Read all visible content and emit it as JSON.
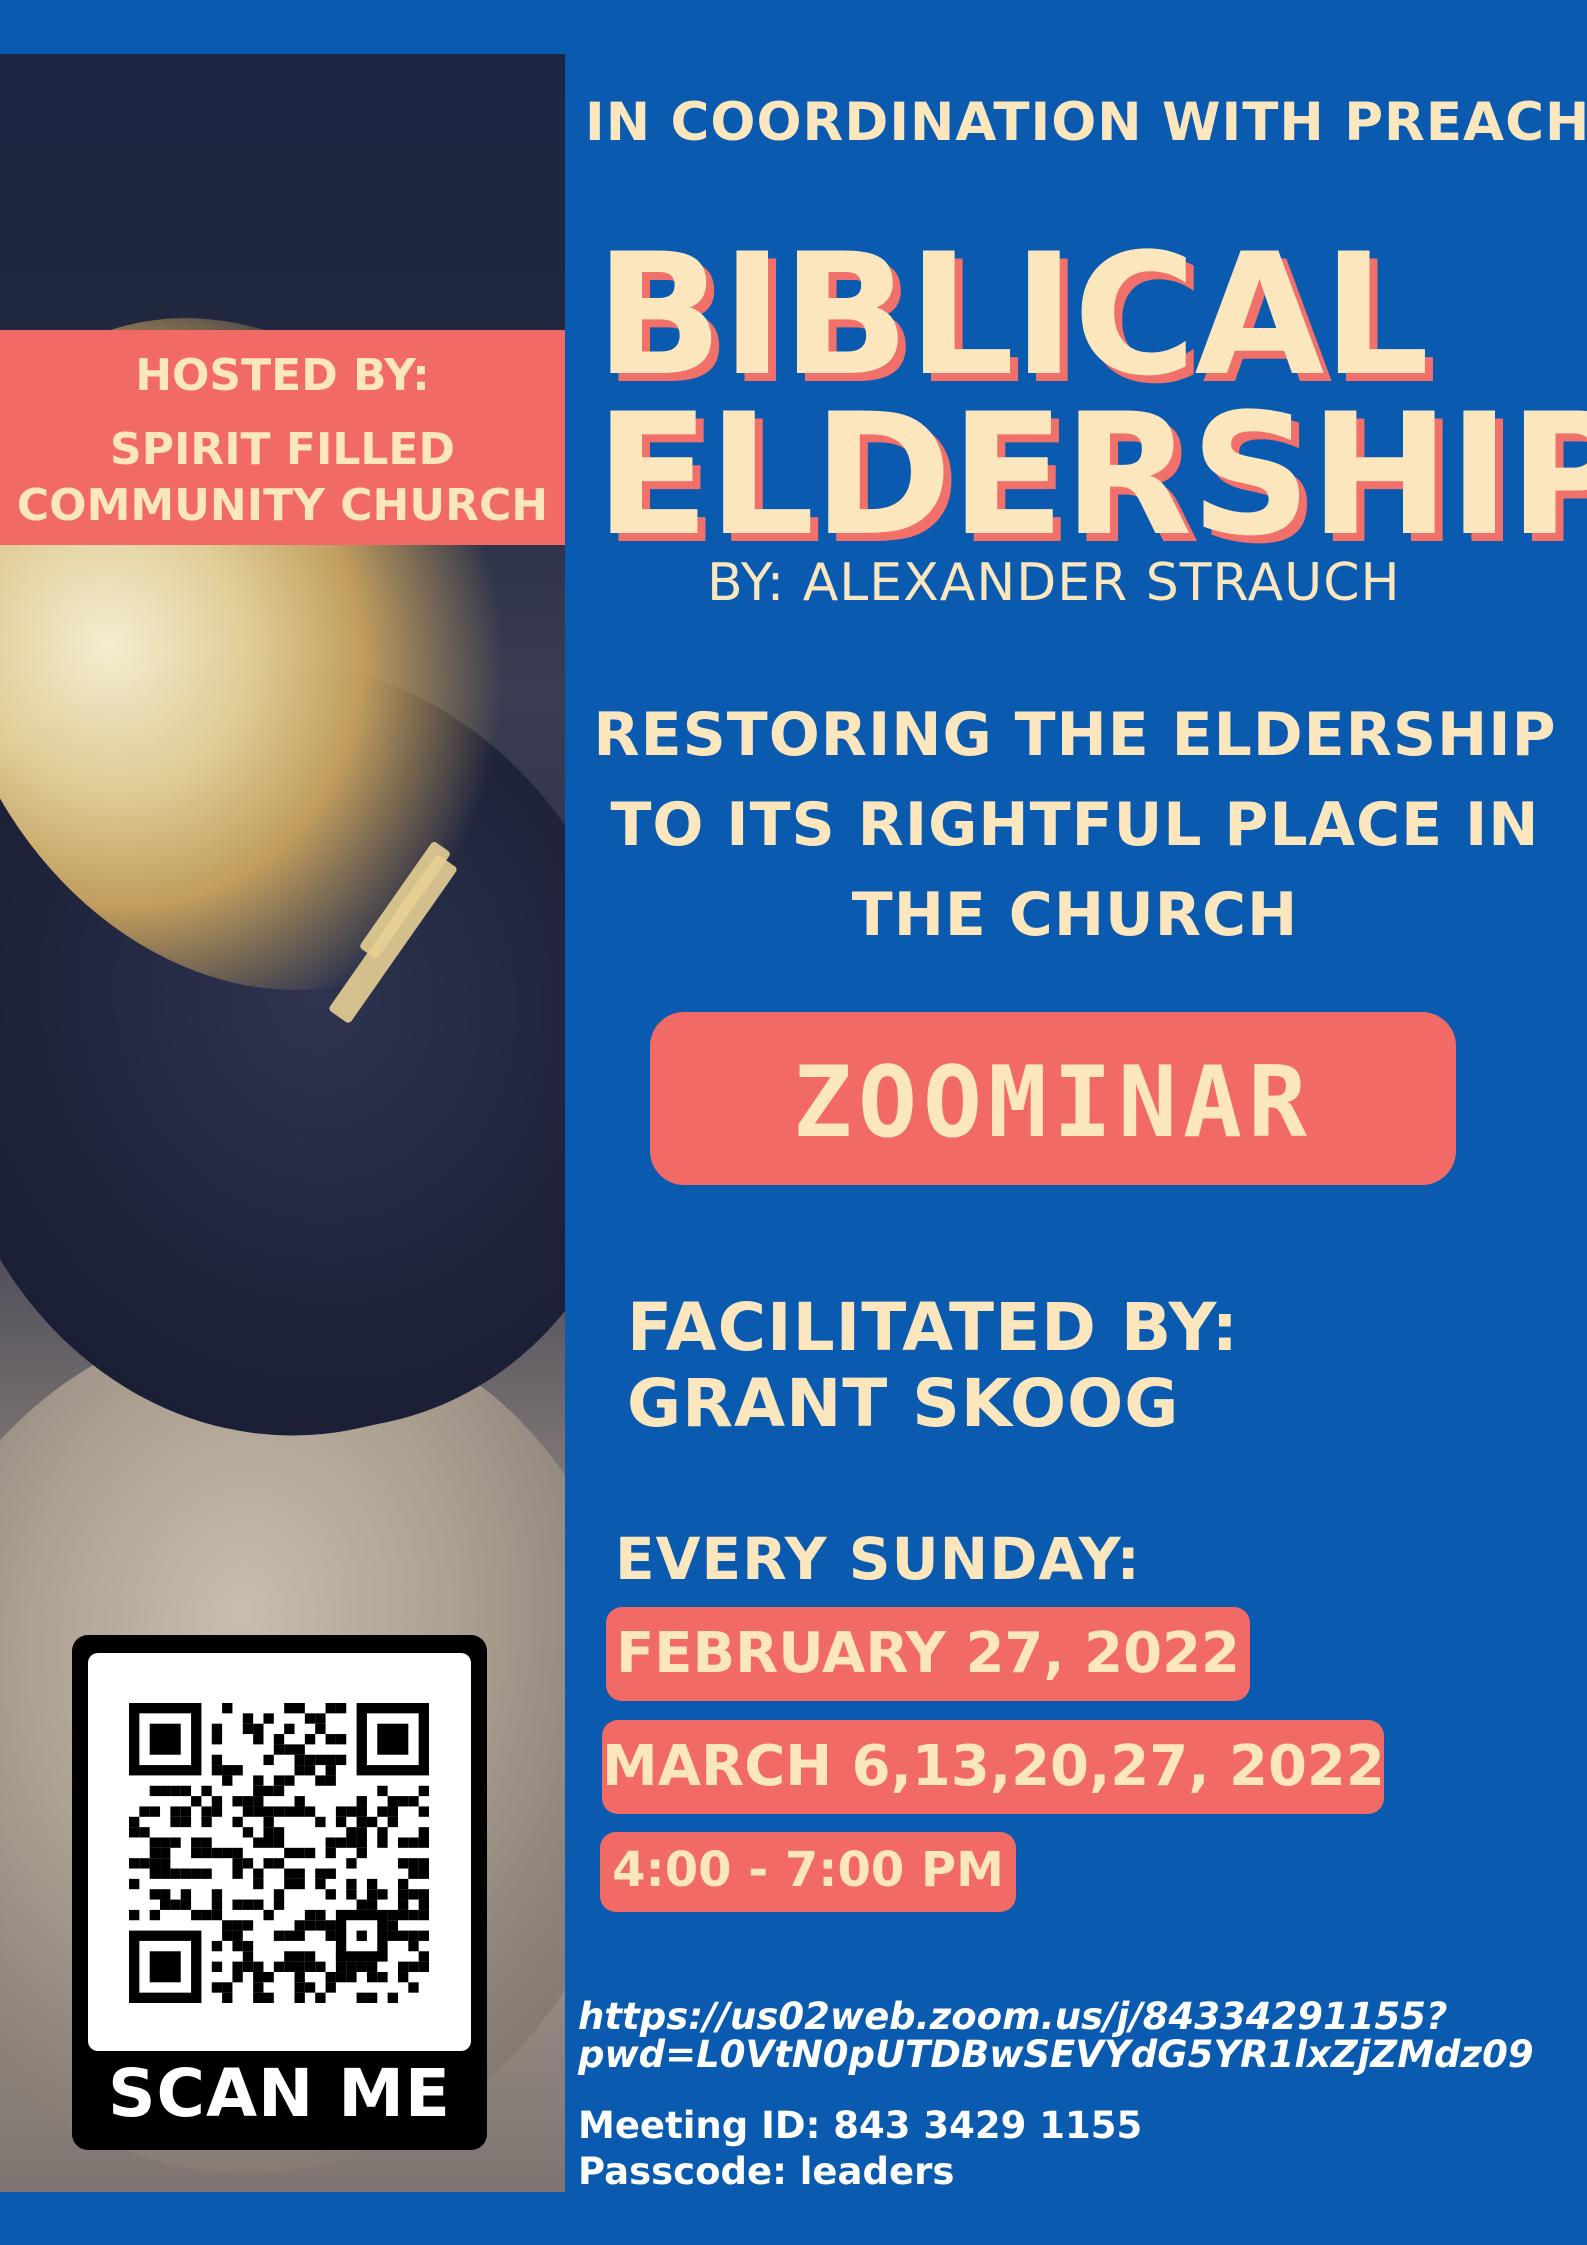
{
  "poster": {
    "coordination": "IN COORDINATION WITH PREACH",
    "title_line1": "BIBLICAL",
    "title_line2": "ELDERSHIP",
    "author": "BY: ALEXANDER STRAUCH",
    "subtitle": "RESTORING THE ELDERSHIP TO ITS RIGHTFUL PLACE IN THE CHURCH",
    "badge": "ZOOMINAR",
    "facilitated_label": "FACILITATED BY:",
    "facilitator": "GRANT SKOOG",
    "schedule_label": "EVERY SUNDAY:",
    "dates": [
      "FEBRUARY 27, 2022",
      "MARCH 6,13,20,27, 2022"
    ],
    "time": "4:00 - 7:00 PM",
    "link_line1": "https://us02web.zoom.us/j/84334291155?",
    "link_line2": "pwd=L0VtN0pUTDBwSEVYdG5YR1lxZjZMdz09",
    "meeting_id": "Meeting ID: 843 3429 1155",
    "passcode": "Passcode: leaders"
  },
  "hosted": {
    "label": "HOSTED BY:",
    "church_line1": "SPIRIT FILLED",
    "church_line2": "COMMUNITY CHURCH"
  },
  "qr": {
    "label": "SCAN ME"
  },
  "colors": {
    "background": "#0a5ab0",
    "accent": "#f26a66",
    "cream": "#fbe6bd"
  }
}
